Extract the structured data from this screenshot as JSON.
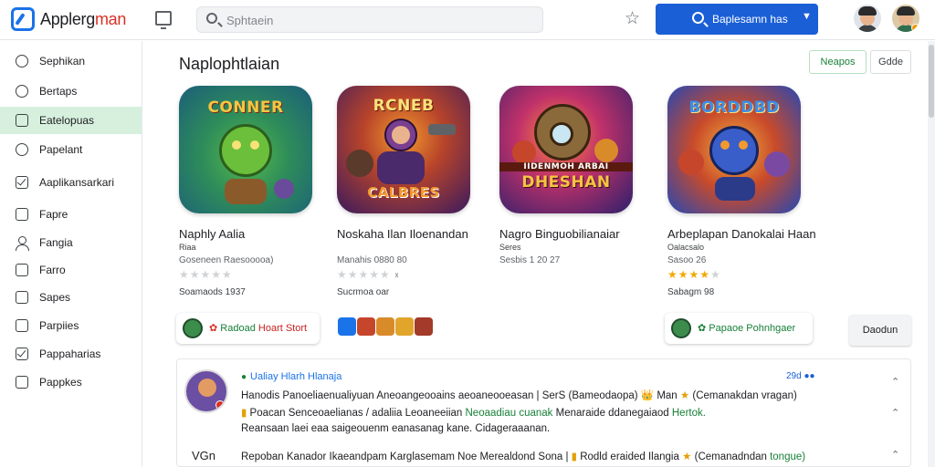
{
  "header": {
    "app_name_main": "Applerg",
    "app_name_accent": "man",
    "search_placeholder": "Sphtaein",
    "primary_button_label": "Baplesamn has",
    "colors": {
      "brand_blue": "#1a5fd6",
      "accent_green": "#188038",
      "star_gold": "#f2a900"
    }
  },
  "sidebar": {
    "items": [
      {
        "label": "Sephikan",
        "icon": "circle-icon"
      },
      {
        "label": "Bertaps",
        "icon": "chat-icon"
      },
      {
        "label": "Eatelopuas",
        "icon": "image-icon",
        "active": true
      },
      {
        "label": "Papelant",
        "icon": "bubble-icon"
      },
      {
        "label": "Aaplikansarkari",
        "icon": "check-square-icon"
      },
      {
        "label": "Fapre",
        "icon": "document-icon"
      },
      {
        "label": "Fangia",
        "icon": "person-icon"
      },
      {
        "label": "Farro",
        "icon": "list-icon"
      },
      {
        "label": "Sapes",
        "icon": "list-icon"
      },
      {
        "label": "Parpiies",
        "icon": "share-icon"
      },
      {
        "label": "Pappaharias",
        "icon": "checkbox-icon"
      },
      {
        "label": "Pappkes",
        "icon": "list-icon"
      }
    ]
  },
  "main": {
    "section_title": "Naplophtlaian",
    "buttons": {
      "green": "Neapos",
      "plain": "Gdde"
    },
    "apps": [
      {
        "name": "Naphly Aalia",
        "sub": "Riaa",
        "meta": "Goseneen Raesooooa)",
        "rating": 0,
        "count": "Soamaods 1937",
        "thumb_title": "CONNER",
        "thumb_sub": "",
        "colors": [
          "#1b7a8c",
          "#57b94a"
        ]
      },
      {
        "name": "Noskaha Ilan Iloenandan",
        "sub": "",
        "meta": "Manahis 0880 80",
        "rating": 0,
        "count": "Sucrmoa oar",
        "thumb_title": "RCNEB",
        "thumb_sub": "CALBRES",
        "colors": [
          "#3a1a5e",
          "#f29a2e"
        ]
      },
      {
        "name": "Nagro Binguobilianaiar",
        "sub": "Seres",
        "meta": "Sesbis 1 20 27",
        "rating": 0,
        "count": "",
        "thumb_title": "",
        "thumb_sub": "DHESHAN",
        "colors": [
          "#2c1f6b",
          "#e0523a"
        ]
      },
      {
        "name": "Arbeplapan Danokalai Haan",
        "sub": "Oalacsalo",
        "meta": "Sasoo 26",
        "rating": 4,
        "count": "Sabagm 98",
        "thumb_title": "BORDDBD",
        "thumb_sub": "",
        "colors": [
          "#2447b5",
          "#f2b33d"
        ]
      }
    ],
    "pills": {
      "first": {
        "accent": "Radoad",
        "text": "Hoart Stort"
      },
      "last": {
        "accent": "Papaoe",
        "text": "Pohnhgaer"
      },
      "dismiss": "Daodun"
    }
  },
  "review": {
    "user": "Ualiay Hlarh Hlanaja",
    "time": "29d",
    "lines": [
      {
        "text": "Hanodis Panoeliaenualiyuan Aneoangeooains aeoaneooeasan | SerS (Bameodaopa)",
        "gold": "Man",
        "tail": "(Cemanakdan vragan)"
      },
      {
        "text": "Poacan Senceoaelianas / adaliia Leoaneeiian",
        "hl": "Neoaadiau cuanak",
        "tail": "Menaraide ddanegaiaod",
        "hl2": "Hertok."
      },
      {
        "text": "Reansaan laei eaa saigeouenm eanasanag kane. Cidageraaanan."
      },
      {
        "text": "Repoban Kanador Ikaeandpam Karglasemam Noe Merealdond Sona |",
        "gold": "Rodld eraided Ilangia",
        "tail": "(Cemanadndan",
        "hl": "tongue)"
      }
    ],
    "label": "VGn"
  }
}
